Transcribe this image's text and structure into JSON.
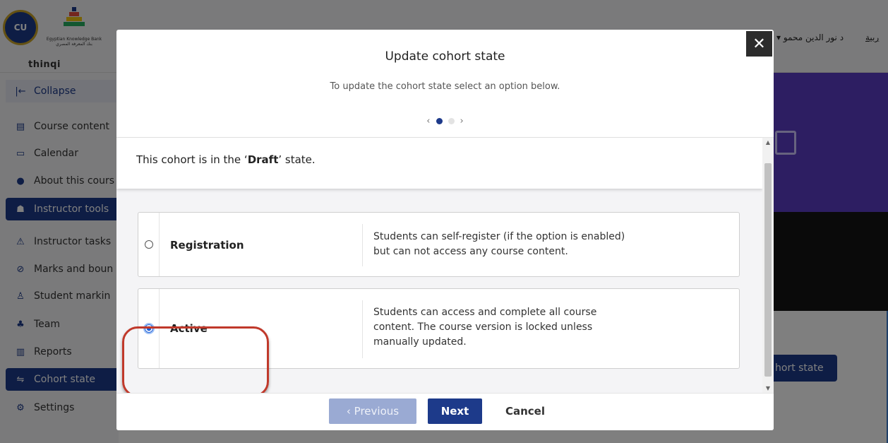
{
  "app": {
    "logo_cu": "CU",
    "logo_ekb_en": "Egyptian Knowledge Bank",
    "logo_ekb_ar": "بنك المعرفة المصري",
    "logo_thinqi": "thinqi",
    "user_name": "▾ د نور الدين محمو",
    "language_link": "ربية"
  },
  "sidebar": {
    "items": [
      {
        "label": "Collapse",
        "icon": "collapse-icon"
      },
      {
        "label": "Course content",
        "icon": "book-icon"
      },
      {
        "label": "Calendar",
        "icon": "calendar-icon"
      },
      {
        "label": "About this cours",
        "icon": "info-icon"
      },
      {
        "label": "Instructor tools",
        "icon": "graduation-cap-icon"
      },
      {
        "label": "Instructor tasks",
        "icon": "warning-icon"
      },
      {
        "label": "Marks and boun",
        "icon": "check-circle-icon"
      },
      {
        "label": "Student markin",
        "icon": "user-icon"
      },
      {
        "label": "Team",
        "icon": "team-icon"
      },
      {
        "label": "Reports",
        "icon": "reports-icon"
      },
      {
        "label": "Cohort state",
        "icon": "cohort-state-icon"
      },
      {
        "label": "Settings",
        "icon": "gear-icon"
      }
    ]
  },
  "background": {
    "cohort_state_button": "hort state"
  },
  "modal": {
    "close_label": "✕",
    "title": "Update cohort state",
    "subtitle": "To update the cohort state select an option below.",
    "pager": {
      "prev": "‹",
      "next": "›",
      "pages": 2,
      "current": 1
    },
    "state_prefix": "This cohort is in the ‘",
    "state_value": "Draft",
    "state_suffix": "’ state.",
    "options": [
      {
        "name": "Registration",
        "selected": false,
        "desc_lines": [
          "Students can self-register (if the option is enabled)",
          "but can not access any course content."
        ]
      },
      {
        "name": "Active",
        "selected": true,
        "desc_lines": [
          "Students can access and complete all course",
          "content. The course version is locked unless",
          "manually updated."
        ]
      }
    ],
    "footer": {
      "previous_label": "‹  Previous",
      "next_label": "Next",
      "cancel_label": "Cancel"
    }
  },
  "colors": {
    "primary": "#1d3a8a",
    "hero": "#5b3cc4",
    "annotation_ring": "#c0392b",
    "radio_selected": "#1a5bd6"
  }
}
